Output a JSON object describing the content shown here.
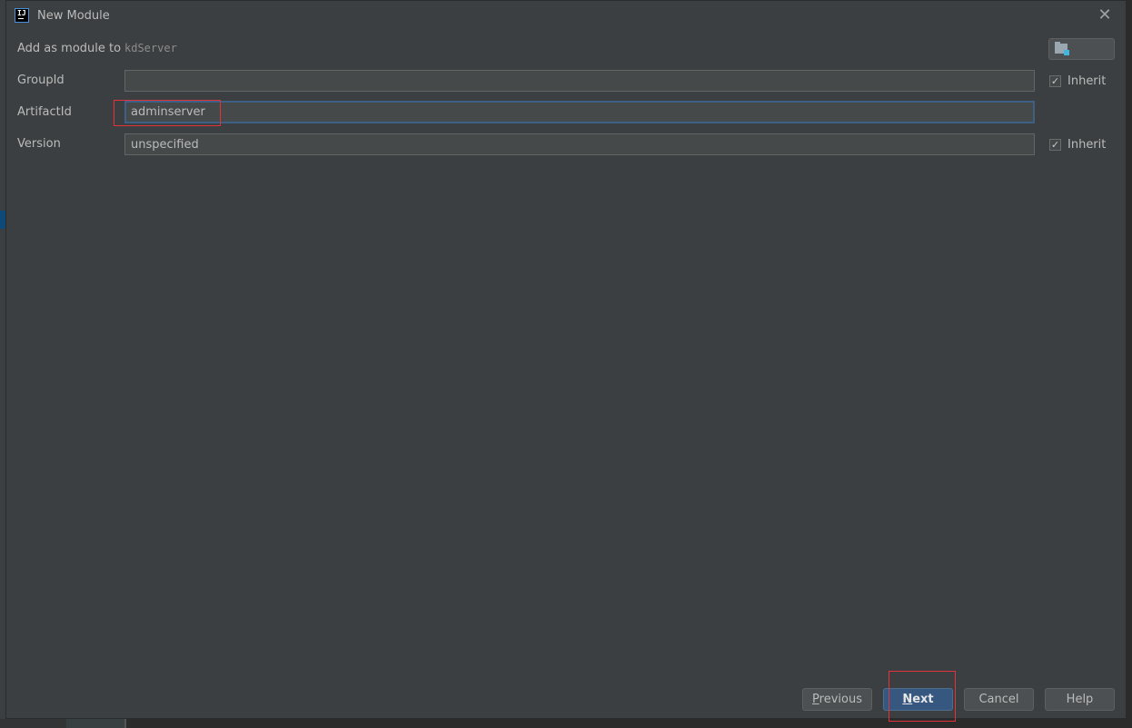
{
  "dialog": {
    "title": "New Module",
    "app_icon": "intellij-idea-icon",
    "close_icon": "close-icon"
  },
  "form": {
    "add_as_module": {
      "label": "Add as module to",
      "value": "kdServer",
      "browse_icon": "folder-icon"
    },
    "group_id": {
      "label": "GroupId",
      "value": "",
      "inherit_label": "Inherit",
      "inherit_checked": true
    },
    "artifact_id": {
      "label": "ArtifactId",
      "value": "adminserver"
    },
    "version": {
      "label": "Version",
      "value": "unspecified",
      "inherit_label": "Inherit",
      "inherit_checked": true
    }
  },
  "buttons": {
    "previous": {
      "mnemonic": "P",
      "rest": "revious"
    },
    "next": {
      "mnemonic": "N",
      "rest": "ext"
    },
    "cancel": "Cancel",
    "help": "Help"
  },
  "colors": {
    "dialog_bg": "#3c3f41",
    "primary_button": "#365880",
    "focus_border": "#3d6185",
    "annotation_red": "#e0333a"
  }
}
